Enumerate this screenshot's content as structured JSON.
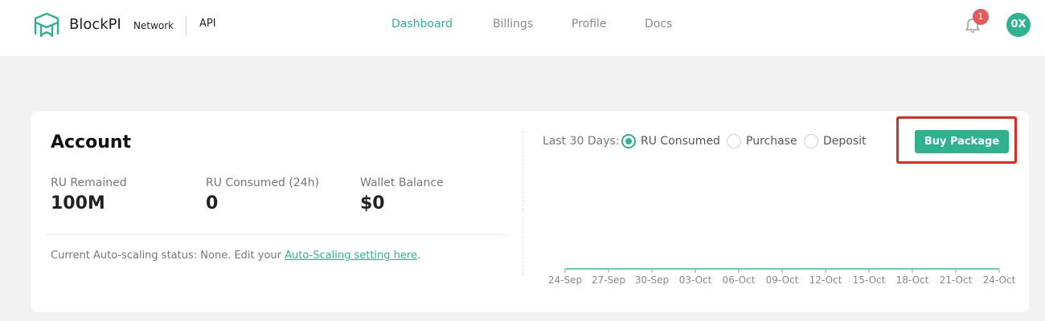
{
  "header": {
    "brand": "BlockPI",
    "brand_sub": "Network",
    "product": "API",
    "nav": [
      {
        "label": "Dashboard",
        "active": true
      },
      {
        "label": "Billings",
        "active": false
      },
      {
        "label": "Profile",
        "active": false
      },
      {
        "label": "Docs",
        "active": false
      }
    ],
    "notification_count": "1",
    "avatar_initials": "0X",
    "accent_color": "#2fb38f"
  },
  "account": {
    "title": "Account",
    "stats": [
      {
        "label": "RU Remained",
        "value": "100M"
      },
      {
        "label": "RU Consumed (24h)",
        "value": "0"
      },
      {
        "label": "Wallet Balance",
        "value": "$0"
      }
    ],
    "autoscale_text": "Current Auto-scaling status: None. Edit your ",
    "autoscale_link": "Auto-Scaling setting here",
    "autoscale_suffix": "."
  },
  "chart_panel": {
    "range_label": "Last 30 Days:",
    "options": [
      {
        "label": "RU Consumed",
        "checked": true
      },
      {
        "label": "Purchase",
        "checked": false
      },
      {
        "label": "Deposit",
        "checked": false
      }
    ],
    "buy_button": "Buy Package"
  },
  "chart_data": {
    "type": "line",
    "x": [
      "24-Sep",
      "27-Sep",
      "30-Sep",
      "03-Oct",
      "06-Oct",
      "09-Oct",
      "12-Oct",
      "15-Oct",
      "18-Oct",
      "21-Oct",
      "24-Oct"
    ],
    "series": [
      {
        "values": [
          0,
          0,
          0,
          0,
          0,
          0,
          0,
          0,
          0,
          0,
          0
        ]
      }
    ],
    "line_color": "#5fd3a3"
  }
}
